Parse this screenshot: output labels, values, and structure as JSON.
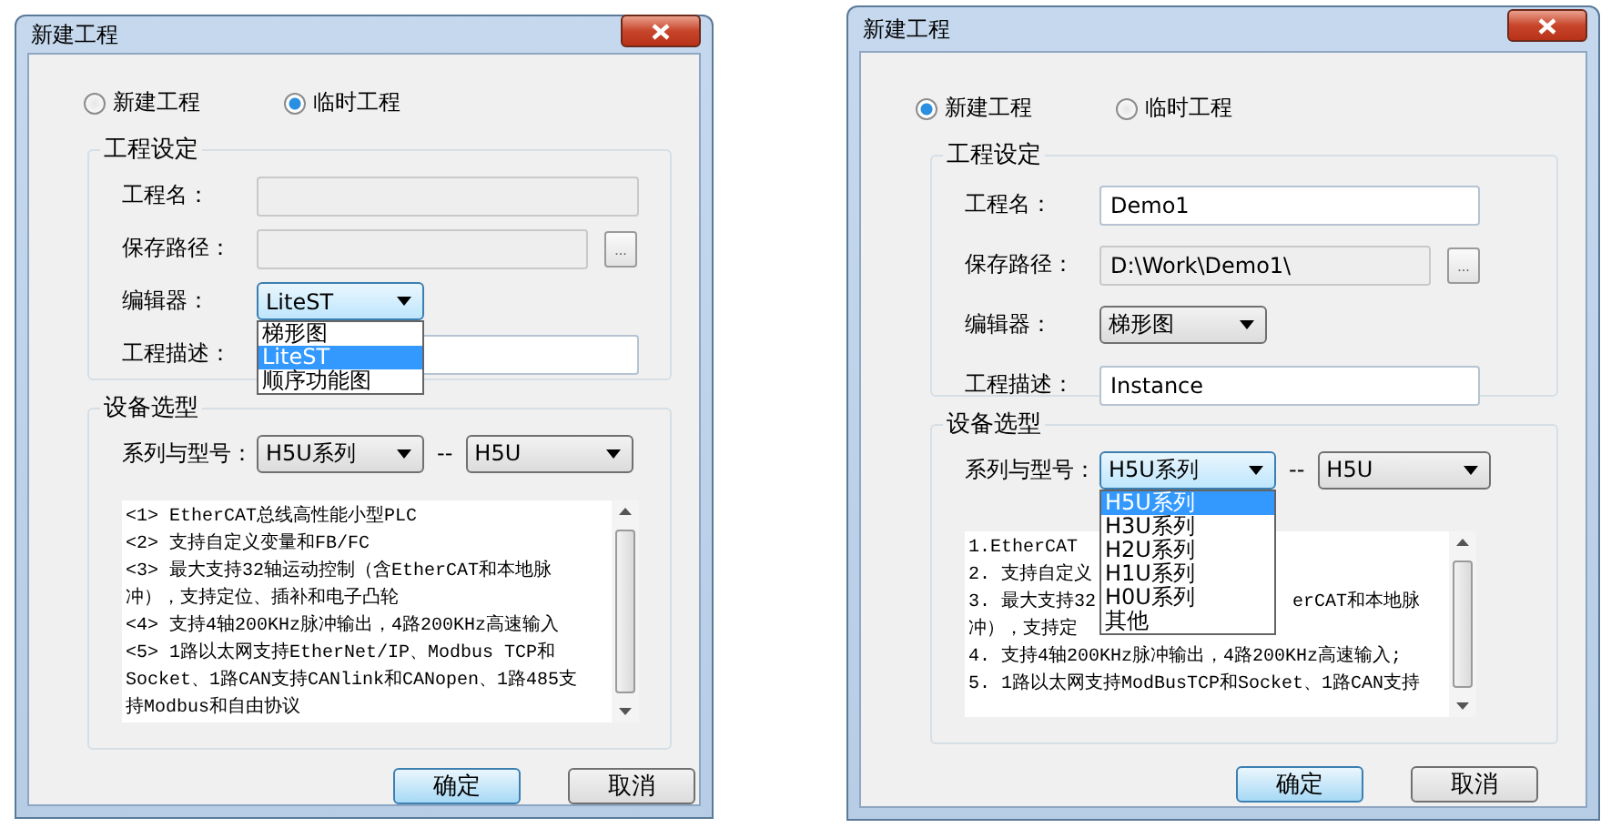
{
  "dialogs": [
    {
      "title": "新建工程",
      "mode_options": [
        {
          "label": "新建工程",
          "selected": false
        },
        {
          "label": "临时工程",
          "selected": true
        }
      ],
      "project_settings": {
        "title": "工程设定",
        "name": {
          "label": "工程名：",
          "disabled": true
        },
        "path": {
          "label": "保存路径：",
          "disabled": true,
          "browse": "..."
        },
        "editor": {
          "label": "编辑器：",
          "value": "LiteST",
          "expanded": true,
          "options": [
            {
              "label": "梯形图",
              "selected": false
            },
            {
              "label": "LiteST",
              "selected": true
            },
            {
              "label": "顺序功能图",
              "selected": false
            }
          ]
        },
        "description": {
          "label": "工程描述：",
          "disabled": false
        }
      },
      "device": {
        "title": "设备选型",
        "series_label": "系列与型号：",
        "series": {
          "value": "H5U系列",
          "expanded": false
        },
        "separator": "--",
        "model": {
          "value": "H5U",
          "expanded": false
        },
        "info_lines": [
          {
            "left": "<1> EtherCAT总线高性能小型PLC"
          },
          {
            "left": "<2> 支持自定义变量和FB/FC"
          },
          {
            "left": "<3> 最大支持32轴运动控制（含EtherCAT和本地脉"
          },
          {
            "left": "冲），支持定位、插补和电子凸轮"
          },
          {
            "left": "<4> 支持4轴200KHz脉冲输出，4路200KHz高速输入"
          },
          {
            "left": "<5> 1路以太网支持EtherNet/IP、Modbus TCP和"
          },
          {
            "left": "Socket、1路CAN支持CANlink和CANopen、1路485支"
          },
          {
            "left": "持Modbus和自由协议"
          }
        ]
      },
      "buttons": [
        {
          "label": "确定",
          "default": true
        },
        {
          "label": "取消",
          "default": false
        }
      ]
    },
    {
      "title": "新建工程",
      "mode_options": [
        {
          "label": "新建工程",
          "selected": true
        },
        {
          "label": "临时工程",
          "selected": false
        }
      ],
      "project_settings": {
        "title": "工程设定",
        "name": {
          "label": "工程名：",
          "value": "Demo1",
          "disabled": false
        },
        "path": {
          "label": "保存路径：",
          "value": "D:\\Work\\Demo1\\",
          "disabled": true,
          "browse": "..."
        },
        "editor": {
          "label": "编辑器：",
          "value": "梯形图",
          "expanded": false
        },
        "description": {
          "label": "工程描述：",
          "value": "Instance",
          "disabled": false
        }
      },
      "device": {
        "title": "设备选型",
        "series_label": "系列与型号：",
        "series": {
          "value": "H5U系列",
          "expanded": true,
          "options": [
            {
              "label": "H5U系列",
              "selected": true
            },
            {
              "label": "H3U系列",
              "selected": false
            },
            {
              "label": "H2U系列",
              "selected": false
            },
            {
              "label": "H1U系列",
              "selected": false
            },
            {
              "label": "H0U系列",
              "selected": false
            },
            {
              "label": "其他",
              "selected": false
            }
          ]
        },
        "separator": "--",
        "model": {
          "value": "H5U",
          "expanded": false
        },
        "info_lines": [
          {
            "left": "1.EtherCAT"
          },
          {
            "left": "2. 支持自定义"
          },
          {
            "left": "3. 最大支持32",
            "right": "erCAT和本地脉"
          },
          {
            "left": "冲），支持定"
          },
          {
            "left": "4. 支持4轴200KHz脉冲输出，4路200KHz高速输入;"
          },
          {
            "left": "5. 1路以太网支持ModBusTCP和Socket、1路CAN支持"
          }
        ]
      },
      "buttons": [
        {
          "label": "确定",
          "default": true
        },
        {
          "label": "取消",
          "default": false
        }
      ]
    }
  ]
}
